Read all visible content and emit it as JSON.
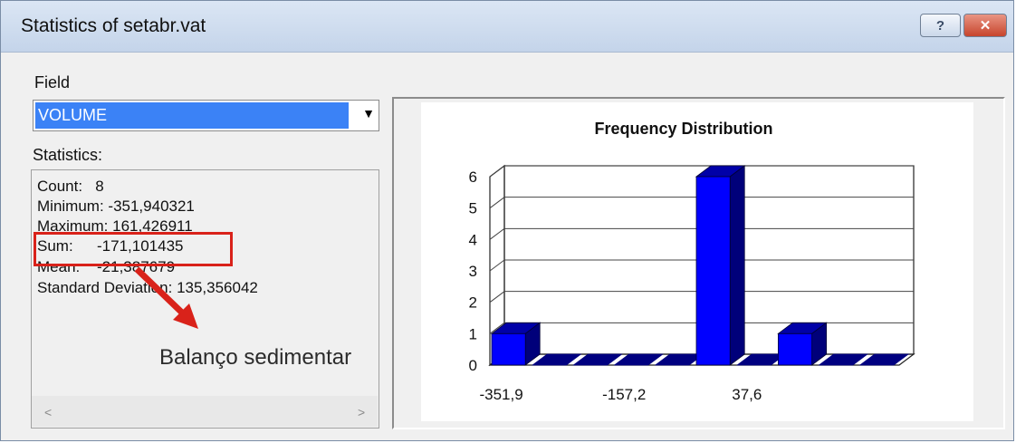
{
  "window": {
    "title": "Statistics of setabr.vat",
    "help_glyph": "?",
    "close_glyph": "✕"
  },
  "field": {
    "label": "Field",
    "value": "VOLUME"
  },
  "statistics": {
    "label": "Statistics:",
    "count_label": "Count:",
    "count_value": "8",
    "min_label": "Minimum:",
    "min_value": "-351,940321",
    "max_label": "Maximum:",
    "max_value": "161,426911",
    "sum_label": "Sum:",
    "sum_value": "-171,101435",
    "mean_label": "Mean:",
    "mean_value": "-21,387679",
    "std_label": "Standard Deviation:",
    "std_value": "135,356042"
  },
  "annotation": "Balanço sedimentar",
  "chart_data": {
    "type": "bar",
    "title": "Frequency Distribution",
    "categories": [
      "-351,9",
      "",
      "",
      "",
      "",
      "",
      "",
      "",
      "",
      ""
    ],
    "values": [
      1,
      0,
      0,
      0,
      0,
      6,
      0,
      1,
      0,
      0
    ],
    "x_tick_labels": [
      "-351,9",
      "-157,2",
      "37,6"
    ],
    "y_ticks": [
      "0",
      "1",
      "2",
      "3",
      "4",
      "5",
      "6"
    ],
    "ylim": [
      0,
      6
    ],
    "bar_color": "#0000ff",
    "grid": true
  }
}
